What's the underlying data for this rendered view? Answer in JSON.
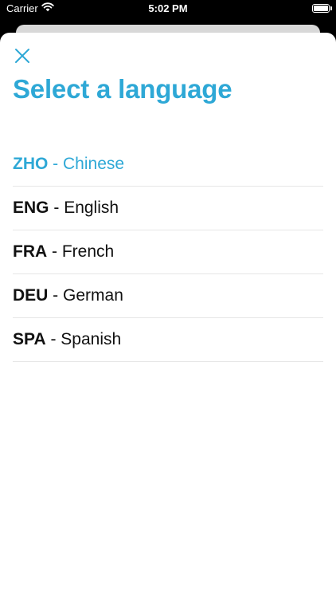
{
  "status_bar": {
    "carrier": "Carrier",
    "time": "5:02 PM",
    "icons": [
      "wifi-icon",
      "battery-icon"
    ]
  },
  "header": {
    "close_icon": "close-icon",
    "title": "Select a language"
  },
  "languages": [
    {
      "code": "ZHO",
      "separator": " - ",
      "name": "Chinese",
      "selected": true
    },
    {
      "code": "ENG",
      "separator": " - ",
      "name": "English",
      "selected": false
    },
    {
      "code": "FRA",
      "separator": " - ",
      "name": "French",
      "selected": false
    },
    {
      "code": "DEU",
      "separator": " - ",
      "name": "German",
      "selected": false
    },
    {
      "code": "SPA",
      "separator": " - ",
      "name": "Spanish",
      "selected": false
    }
  ],
  "colors": {
    "accent": "#2ea8d6",
    "text": "#111111",
    "divider": "#e6e6e6",
    "background": "#ffffff",
    "status_bar_background": "#000000"
  }
}
